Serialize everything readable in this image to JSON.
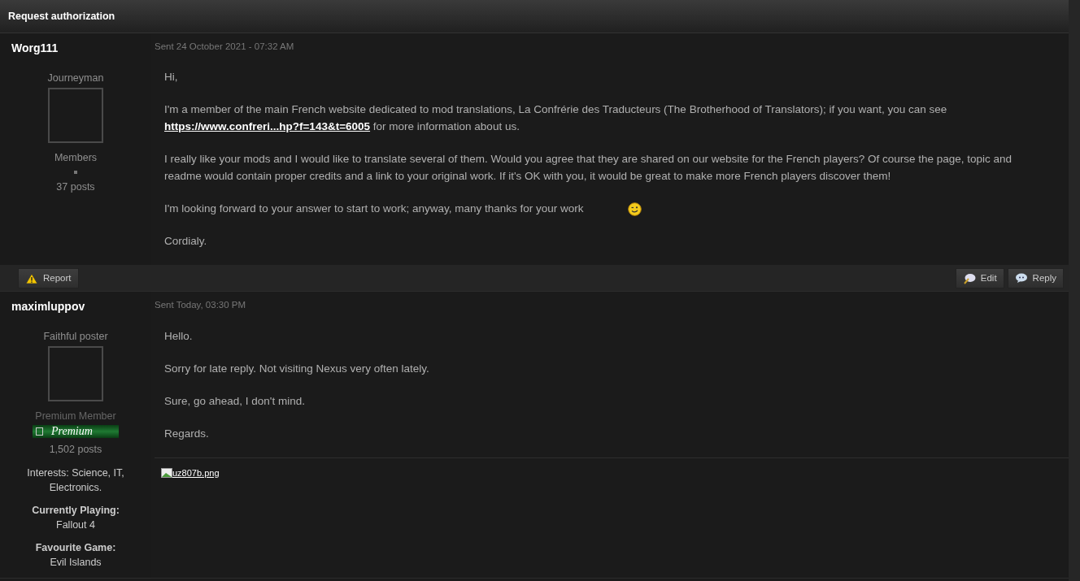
{
  "title": "Request authorization",
  "posts": [
    {
      "author": "Worg111",
      "rank": "Journeyman",
      "group": "Members",
      "separator": true,
      "posts": "37 posts",
      "date": "Sent 24 October 2021 - 07:32 AM",
      "paragraphs": [
        {
          "kind": "text",
          "text": "Hi,"
        },
        {
          "kind": "link",
          "before": "I'm a member of the main French website dedicated to mod translations, La Confrérie des Traducteurs (The Brotherhood of Translators); if you want, you can see ",
          "link": "https://www.confreri...hp?f=143&t=6005",
          "after": " for more information about us."
        },
        {
          "kind": "text",
          "text": "I really like your mods and I would like to translate several of them. Would you agree that they are shared on our website for the French players? Of course the page, topic and readme would contain proper credits and a link to your original work. If it's OK with you, it would be great to make more French players discover them!"
        },
        {
          "kind": "emoticon",
          "text": "I'm looking forward to your answer to start to work; anyway, many thanks for your work"
        },
        {
          "kind": "text",
          "text": "Cordialy."
        }
      ],
      "footer": {
        "left": [
          {
            "label": "Report",
            "kind": "report"
          }
        ],
        "right": [
          {
            "label": "Edit",
            "kind": "edit"
          },
          {
            "label": "Reply",
            "kind": "reply"
          }
        ]
      }
    },
    {
      "author": "maximluppov",
      "rank": "Faithful poster",
      "group": "Premium Member",
      "separator": false,
      "badge": "Premium",
      "posts": "1,502 posts",
      "date": "Sent Today, 03:30 PM",
      "profile": [
        {
          "kind": "plain",
          "value": "Interests: Science, IT, Electronics."
        },
        {
          "kind": "field",
          "label": "Currently Playing:",
          "value": "Fallout 4"
        },
        {
          "kind": "field",
          "label": "Favourite Game:",
          "value": "Evil Islands"
        }
      ],
      "paragraphs": [
        {
          "kind": "text",
          "text": "Hello."
        },
        {
          "kind": "text",
          "text": "Sorry for late reply. Not visiting Nexus very often lately."
        },
        {
          "kind": "text",
          "text": "Sure, go ahead, I don't mind."
        },
        {
          "kind": "text",
          "text": "Regards."
        }
      ],
      "signature": {
        "image_alt": "uz807b.png"
      }
    }
  ]
}
